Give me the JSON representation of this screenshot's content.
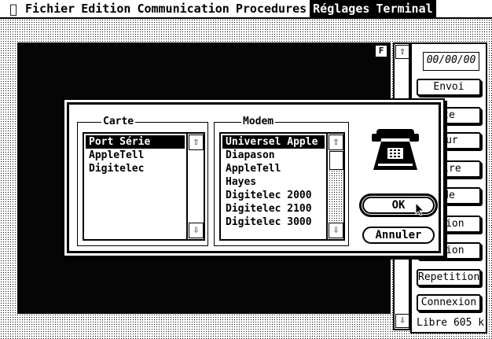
{
  "menubar": {
    "apple_icon": "apple-menu-icon",
    "items": [
      {
        "label": "Fichier"
      },
      {
        "label": "Edition"
      },
      {
        "label": "Communication"
      },
      {
        "label": "Procedures"
      },
      {
        "label": "Réglages"
      },
      {
        "label": "Terminal"
      }
    ]
  },
  "terminal": {
    "marker": "F"
  },
  "side_panel": {
    "date": "00/00/00",
    "buttons": [
      "Envoi",
      "te",
      "our",
      "aire",
      "de",
      "ction",
      "ation",
      "Repetition",
      "Connexion"
    ],
    "free_space": "Libre 605 k"
  },
  "dialog": {
    "carte": {
      "title": "Carte",
      "items": [
        "Port Série",
        "AppleTell",
        "Digitelec"
      ],
      "selected_index": 0
    },
    "modem": {
      "title": "Modem",
      "items": [
        "Universel Apple",
        "Diapason",
        "AppleTell",
        "Hayes",
        "Digitelec 2000",
        "Digitelec 2100",
        "Digitelec 3000"
      ],
      "selected_index": 0
    },
    "icon": "telephone-icon",
    "ok_label": "OK",
    "cancel_label": "Annuler"
  },
  "colors": {
    "foreground": "#000000",
    "background": "#ffffff"
  }
}
